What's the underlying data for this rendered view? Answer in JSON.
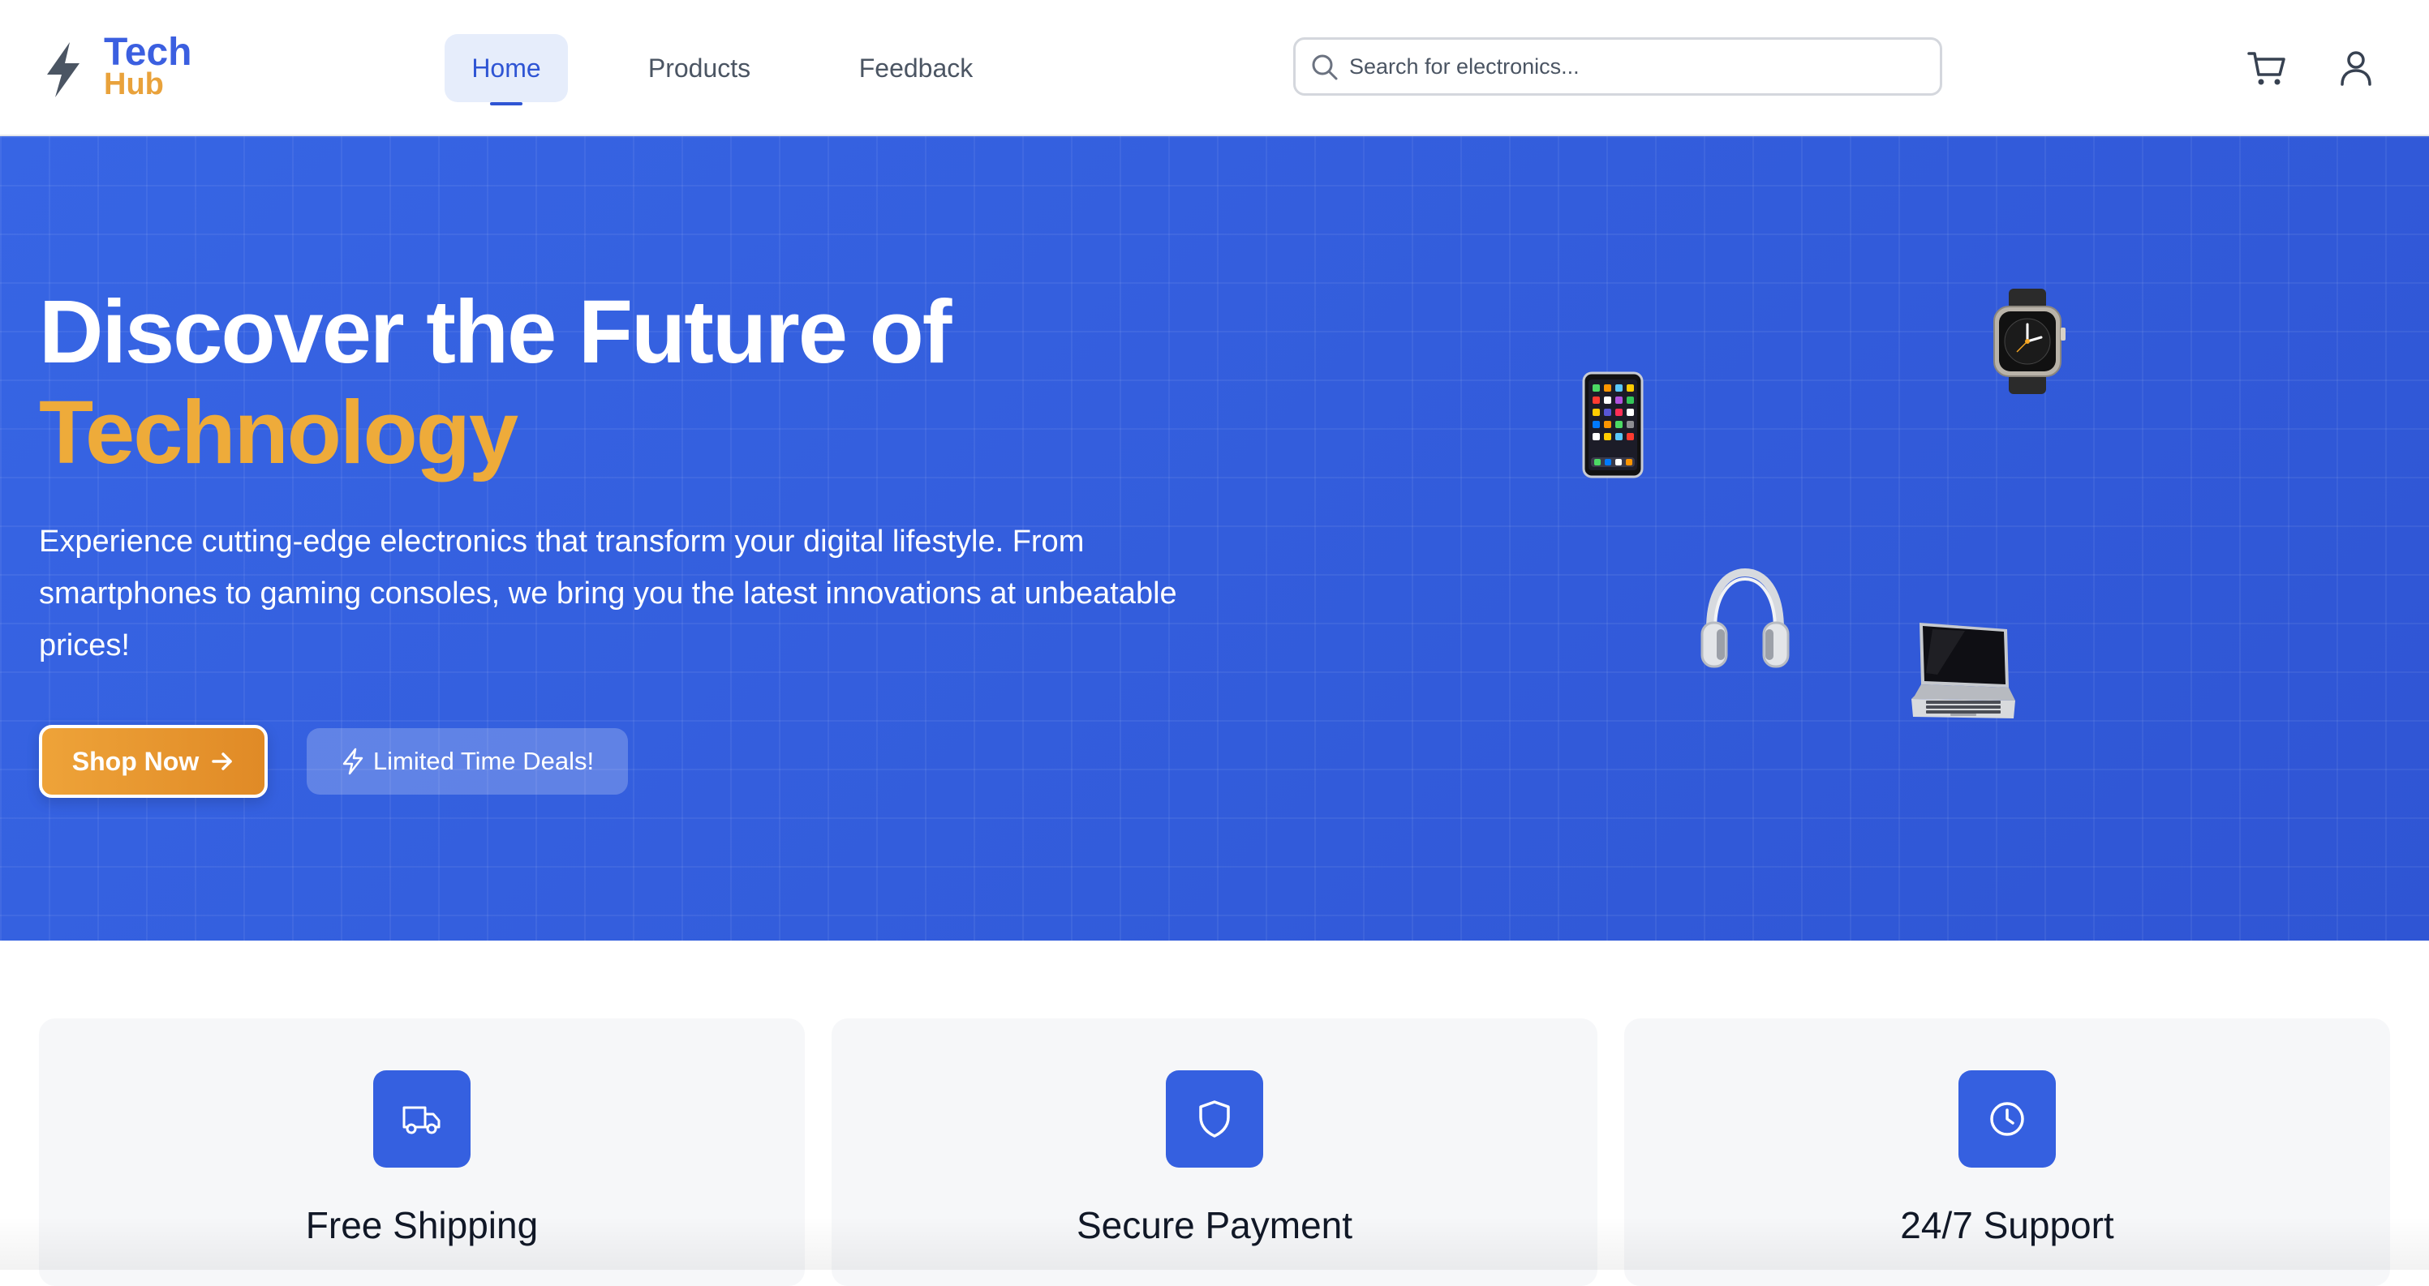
{
  "header": {
    "logo": {
      "line1": "Tech",
      "line2": "Hub"
    },
    "nav": [
      {
        "label": "Home",
        "active": true
      },
      {
        "label": "Products",
        "active": false
      },
      {
        "label": "Feedback",
        "active": false
      }
    ],
    "search": {
      "placeholder": "Search for electronics...",
      "value": ""
    },
    "icons": [
      "cart-icon",
      "user-icon"
    ]
  },
  "hero": {
    "title_line1": "Discover the Future of",
    "title_line2": "Technology",
    "description": "Experience cutting-edge electronics that transform your digital lifestyle. From smartphones to gaming consoles, we bring you the latest innovations at unbeatable prices!",
    "primary_button": "Shop Now",
    "secondary_button": "Limited Time Deals!",
    "devices": [
      "smartphone",
      "watch",
      "headphones",
      "laptop"
    ]
  },
  "features": [
    {
      "title": "Free Shipping",
      "icon": "truck-icon"
    },
    {
      "title": "Secure Payment",
      "icon": "shield-icon"
    },
    {
      "title": "24/7 Support",
      "icon": "clock-icon"
    }
  ],
  "colors": {
    "primary": "#3560e0",
    "accent": "#eeab3a",
    "nav_active_bg": "#e6edfb",
    "card_bg": "#f6f7f9"
  }
}
